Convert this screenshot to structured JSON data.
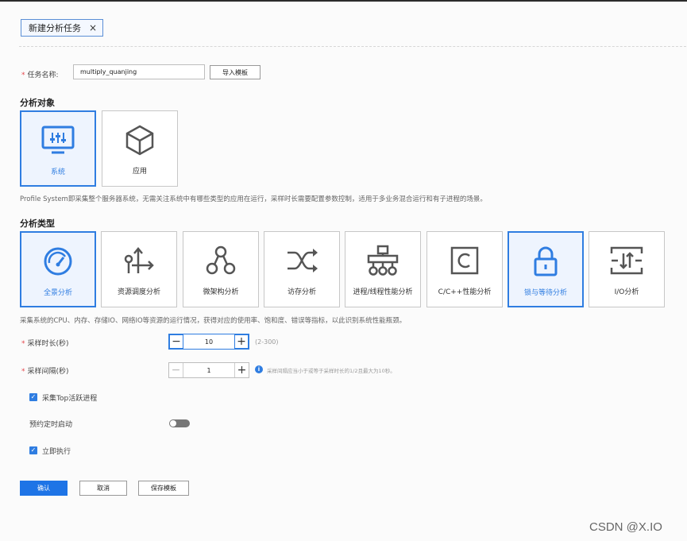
{
  "tab": {
    "title": "新建分析任务",
    "close": "×"
  },
  "task": {
    "name_label": "任务名称:",
    "name_value": "multiply_quanjing",
    "import_button": "导入模板"
  },
  "target": {
    "heading": "分析对象",
    "cards": [
      {
        "label": "系统",
        "icon": "monitor-icon",
        "selected": true
      },
      {
        "label": "应用",
        "icon": "cube-icon",
        "selected": false
      }
    ],
    "description": "Profile System即采集整个服务器系统，无需关注系统中有哪些类型的应用在运行，采样时长需要配置参数控制，适用于多业务混合运行和有子进程的场景。"
  },
  "analysis": {
    "heading": "分析类型",
    "cards": [
      {
        "label": "全景分析",
        "icon": "gauge-icon",
        "selected": true
      },
      {
        "label": "资源调度分析",
        "icon": "schedule-icon",
        "selected": false
      },
      {
        "label": "微架构分析",
        "icon": "microarch-icon",
        "selected": false
      },
      {
        "label": "访存分析",
        "icon": "shuffle-icon",
        "selected": false
      },
      {
        "label": "进程/线程性能分析",
        "icon": "process-tree-icon",
        "selected": false
      },
      {
        "label": "C/C++性能分析",
        "icon": "c-icon",
        "selected": false
      },
      {
        "label": "锁与等待分析",
        "icon": "lock-icon",
        "selected": true
      },
      {
        "label": "I/O分析",
        "icon": "io-icon",
        "selected": false
      }
    ],
    "description": "采集系统的CPU、内存、存储IO、网络IO等资源的运行情况，获得对应的使用率、饱和度、错误等指标，以此识别系统性能瓶颈。"
  },
  "params": {
    "duration_label": "采样时长(秒)",
    "duration_value": "10",
    "duration_range": "(2-300)",
    "interval_label": "采样间隔(秒)",
    "interval_value": "1",
    "interval_hint": "采样间隔应当小于或等于采样时长的1/2且最大为10秒。",
    "minus": "−",
    "plus": "+",
    "info": "i"
  },
  "options": {
    "collect_top_label": "采集Top活跃进程",
    "collect_top_checked": true,
    "scheduled_label": "预约定时启动",
    "scheduled_on": false,
    "run_now_label": "立即执行",
    "run_now_checked": true
  },
  "actions": {
    "confirm": "确认",
    "cancel": "取消",
    "save_template": "保存模板"
  },
  "watermark": "CSDN @X.IO",
  "colors": {
    "accent": "#2f7de1",
    "required": "#e5484d"
  }
}
